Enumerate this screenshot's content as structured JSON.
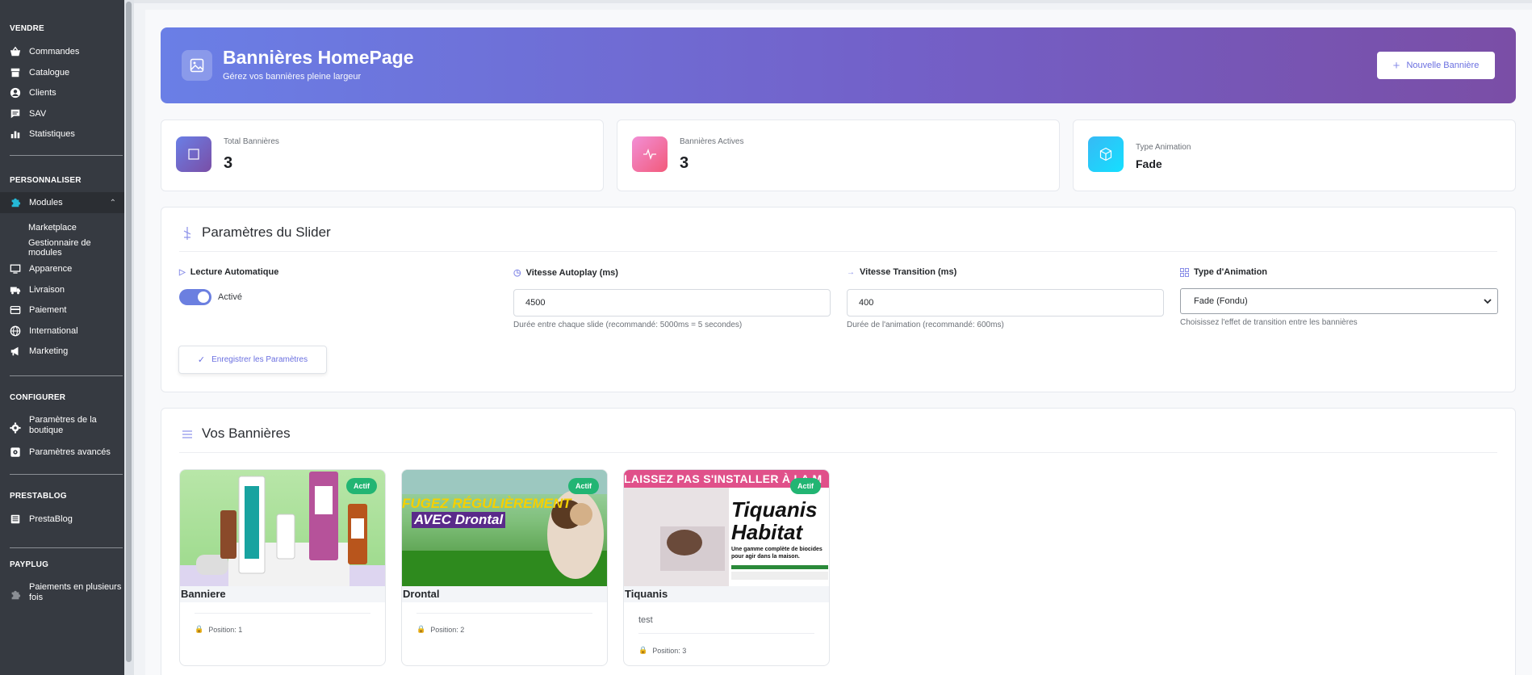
{
  "sidebar": {
    "sections": {
      "vendre": "VENDRE",
      "personnaliser": "PERSONNALISER",
      "configurer": "CONFIGURER",
      "prestablog": "PRESTABLOG",
      "payplug": "PAYPLUG"
    },
    "items": {
      "commandes": "Commandes",
      "catalogue": "Catalogue",
      "clients": "Clients",
      "sav": "SAV",
      "statistiques": "Statistiques",
      "modules": "Modules",
      "marketplace": "Marketplace",
      "gestionnaire": "Gestionnaire de modules",
      "apparence": "Apparence",
      "livraison": "Livraison",
      "paiement": "Paiement",
      "international": "International",
      "marketing": "Marketing",
      "parametres_boutique_1": "Paramètres de la",
      "parametres_boutique_2": "boutique",
      "parametres_avances": "Paramètres avancés",
      "prestablog": "PrestaBlog",
      "paiements_plusieurs_1": "Paiements en plusieurs",
      "paiements_plusieurs_2": "fois"
    }
  },
  "hero": {
    "title": "Bannières HomePage",
    "subtitle": "Gérez vos bannières pleine largeur",
    "button": "Nouvelle Bannière",
    "gradient_start": "#6a7fe6",
    "gradient_end": "#7a4ea6"
  },
  "stats": [
    {
      "label": "Total Bannières",
      "value": "3",
      "icon": "square-icon"
    },
    {
      "label": "Bannières Actives",
      "value": "3",
      "icon": "activity-icon"
    },
    {
      "label": "Type Animation",
      "value": "Fade",
      "icon": "cube-icon"
    }
  ],
  "slider": {
    "title": "Paramètres du Slider",
    "autoplay_label": "Lecture Automatique",
    "autoplay_state": "Activé",
    "autoplay_enabled": true,
    "speed_label": "Vitesse Autoplay (ms)",
    "speed_value": "4500",
    "speed_help": "Durée entre chaque slide (recommandé: 5000ms = 5 secondes)",
    "transition_label": "Vitesse Transition (ms)",
    "transition_value": "400",
    "transition_help": "Durée de l'animation (recommandé: 600ms)",
    "animation_label": "Type d'Animation",
    "animation_value": "Fade (Fondu)",
    "animation_help": "Choisissez l'effet de transition entre les bannières",
    "save_button": "Enregistrer les Paramètres"
  },
  "banners_section": {
    "title": "Vos Bannières",
    "items": [
      {
        "name": "Banniere",
        "badge": "Actif",
        "position": "Position: 1",
        "description": ""
      },
      {
        "name": "Drontal",
        "badge": "Actif",
        "position": "Position: 2",
        "description": "",
        "img_text_1": "FUGEZ RÉGULIÈREMENT",
        "img_text_2": "AVEC Drontal"
      },
      {
        "name": "Tiquanis",
        "badge": "Actif",
        "position": "Position: 3",
        "description": "test",
        "img_text_1": "LAISSEZ PAS S'INSTALLER À LA M",
        "img_text_2": "Tiquanis",
        "img_text_3": "Habitat",
        "img_text_4": "Une gamme complète de biocides pour agir dans la maison."
      }
    ]
  },
  "colors": {
    "sidebar": "#363a41",
    "accent": "#6b7fe0",
    "success": "#22b573"
  }
}
